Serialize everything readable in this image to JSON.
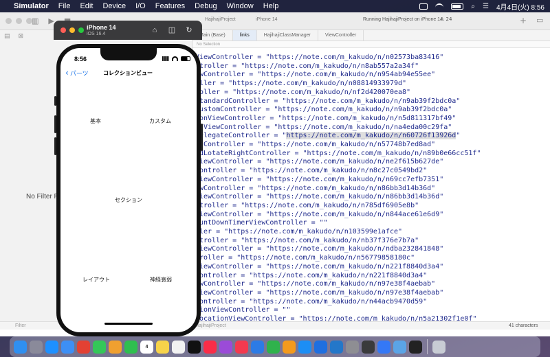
{
  "menubar": {
    "app_name": "Simulator",
    "items": [
      "File",
      "Edit",
      "Device",
      "I/O",
      "Features",
      "Debug",
      "Window",
      "Help"
    ],
    "clock": "4月4日(火) 8:56"
  },
  "xcode": {
    "project": "HajihajiProject",
    "destination": "iPhone 14",
    "run_status": "Running HajihajiProject on iPhone 14",
    "warnings": "24",
    "tabs": [
      "Main (Base)",
      "links",
      "HajihajiClassManager",
      "ViewController"
    ],
    "jumpbar": "No Selection",
    "navigator_empty": "No Filter Results",
    "filter_label": "Filter",
    "filter_project": "HajihajiProject",
    "char_count": "41 characters"
  },
  "code_lines": [
    "ViewController = \"https://note.com/m_kakudo/n/n02573ba83416\"",
    "ntroller = \"https://note.com/m_kakudo/n/n8ab557a2a34f\"",
    "ewController = \"https://note.com/m_kakudo/n/n954ab94e55ee\"",
    "oller = \"https://note.com/m_kakudo/n/n08814933979d\"",
    "roller = \"https://note.com/m_kakudo/n/nf2d420070ea8\"",
    "StandardController = \"https://note.com/m_kakudo/n/n9ab39f2bdc0a\"",
    "CustomController = \"https://note.com/m_kakudo/n/n9ab39f2bdc0a\"",
    "ionViewController = \"https://note.com/m_kakudo/n/n5d811317bf49\"",
    "utViewController = \"https://note.com/m_kakudo/n/na4eda00c29fa\"",
    "DelegateController = \"https://note.com/m_kakudo/n/n60726f13926d\"",
    "rdController = \"https://note.com/m_kakudo/n/n57748b7ed8ad\"",
    "rdLotateRightController = \"https://note.com/m_kakudo/n/n89b0e66cc51f\"",
    "ViewController = \"https://note.com/m_kakudo/n/ne2f615b627de\"",
    "Controller = \"https://note.com/m_kakudo/n/n8c27c0549bd2\"",
    "ViewController = \"https://note.com/m_kakudo/n/n69cc7efb7351\"",
    "ewController = \"https://note.com/m_kakudo/n/n86bb3d14b36d\"",
    "ViewController = \"https://note.com/m_kakudo/n/n86bb3d14b36d\"",
    "ntroller = \"https://note.com/m_kakudo/n/n785df6905e8b\"",
    "ViewController = \"https://note.com/m_kakudo/n/n844ace61e6d9\"",
    "ountDownTimerViewController = \"\"",
    "ller = \"https://note.com/m_kakudo/n/n103599e1afce\"",
    "ntroller = \"https://note.com/m_kakudo/n/nb37f376e7b7a\"",
    "ViewController = \"https://note.com/m_kakudo/n/ndba232841848\"",
    "troller = \"https://note.com/m_kakudo/n/n56779858180c\"",
    "ViewController = \"https://note.com/m_kakudo/n/n221f8840d3a4\"",
    "Controller = \"https://note.com/m_kakudo/n/n221f8840d3a4\"",
    "ewController = \"https://note.com/m_kakudo/n/n97e38f4aebab\"",
    "ViewController = \"https://note.com/m_kakudo/n/n97e38f4aebab\"",
    "Controller = \"https://note.com/m_kakudo/n/n44acb9470d59\"",
    "tionViewController = \"\"",
    "LocationViewController = \"https://note.com/m_kakudo/n/n5a21302f1e0f\"",
    "denceViewController = \"https://note.com/m_kakudo/n/n0ba7f8b8ca2b\""
  ],
  "highlight": {
    "line_index": 9,
    "text": "https://note.com/m_kakudo/n/n60726f13926d"
  },
  "simulator": {
    "device_name": "iPhone 14",
    "os_version": "iOS 16.4",
    "time": "8:56",
    "back_label": "パーツ",
    "nav_title": "コレクションビュー",
    "cells": {
      "basic": "基本",
      "custom": "カスタム",
      "section": "セクション",
      "layout": "レイアウト",
      "memory": "神経衰弱"
    }
  },
  "dock": {
    "calendar_day": "4",
    "apps": [
      "finder-icon",
      "launchpad-icon",
      "safari-icon",
      "mail-icon",
      "chrome-icon",
      "messages-icon",
      "photos-icon",
      "facetime-icon",
      "calendar-icon",
      "notes-icon",
      "reminders-icon",
      "appletv-icon",
      "music-icon",
      "podcasts-icon",
      "news-icon",
      "keynote-icon",
      "numbers-icon",
      "pages-icon",
      "appstore-icon",
      "xcode-icon",
      "vscode-icon",
      "preferences-icon",
      "activity-icon",
      "simulator-icon",
      "preview-icon",
      "terminal-icon",
      "trash-icon"
    ]
  },
  "colors": {
    "accent_blue": "#1a73e8",
    "code_text": "#1f2a8c",
    "traffic_red": "#ff5f57",
    "traffic_yellow": "#febc2e",
    "traffic_green": "#28c840"
  }
}
